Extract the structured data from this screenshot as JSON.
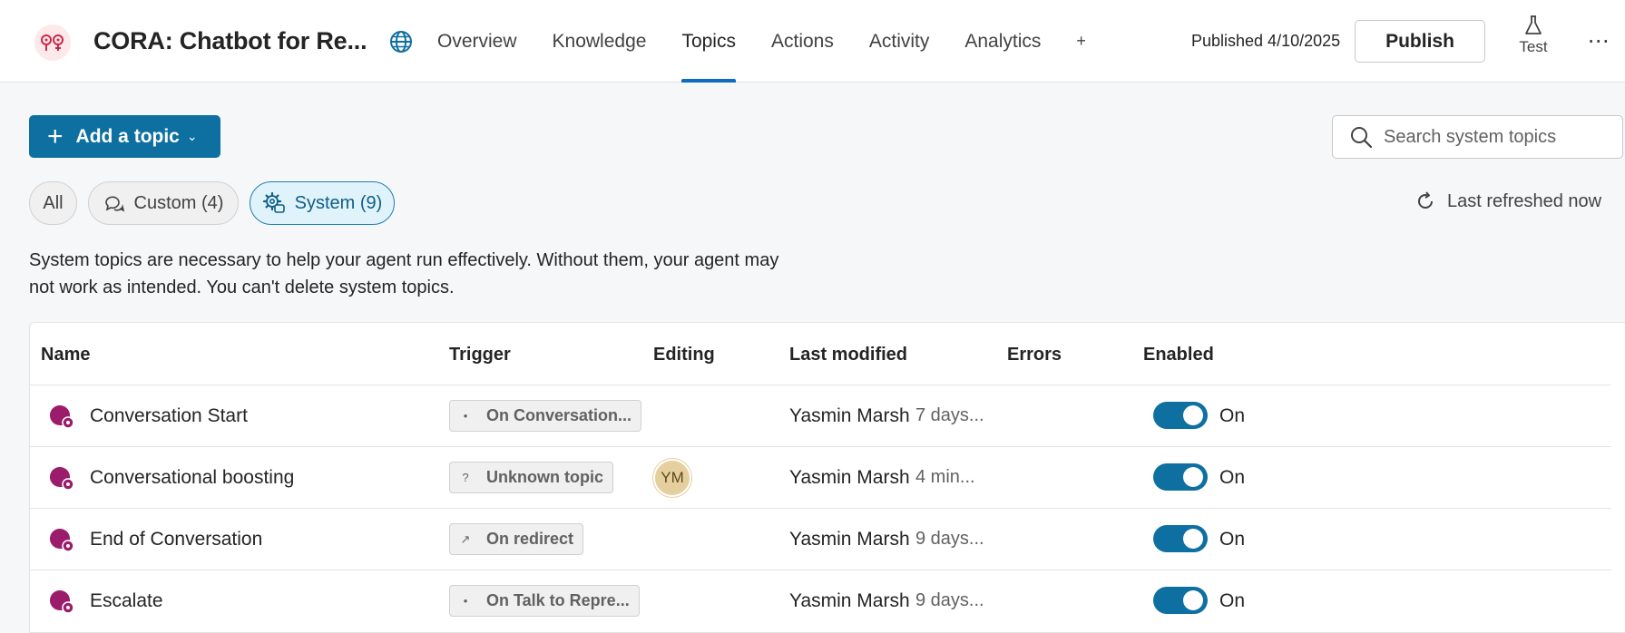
{
  "header": {
    "app_title": "CORA: Chatbot for Re...",
    "nav": [
      {
        "label": "Overview"
      },
      {
        "label": "Knowledge"
      },
      {
        "label": "Topics",
        "active": true
      },
      {
        "label": "Actions"
      },
      {
        "label": "Activity"
      },
      {
        "label": "Analytics"
      },
      {
        "label": "+"
      }
    ],
    "published_text": "Published 4/10/2025",
    "publish_label": "Publish",
    "test_label": "Test",
    "more_label": "⋯"
  },
  "toolbar": {
    "add_topic_label": "Add a topic",
    "search_placeholder": "Search system topics",
    "filters": [
      {
        "label": "All"
      },
      {
        "label": "Custom (4)"
      },
      {
        "label": "System (9)",
        "selected": true
      }
    ],
    "refresh_label": "Last refreshed now"
  },
  "notice": "System topics are necessary to help your agent run effectively. Without them, your agent may not work as intended. You can't delete system topics.",
  "table": {
    "columns": [
      "Name",
      "Trigger",
      "Editing",
      "Last modified",
      "Errors",
      "Enabled"
    ],
    "rows": [
      {
        "name": "Conversation Start",
        "trigger_icon": "lightbulb-icon",
        "trigger_glyph": "•",
        "trigger": "On Conversation...",
        "editing": "",
        "modified_by": "Yasmin Marsh",
        "modified_when": "7 days...",
        "errors": "",
        "enabled": "On"
      },
      {
        "name": "Conversational boosting",
        "trigger_icon": "question-icon",
        "trigger_glyph": "?",
        "trigger": "Unknown topic",
        "editing": "YM",
        "modified_by": "Yasmin Marsh",
        "modified_when": "4 min...",
        "errors": "",
        "enabled": "On"
      },
      {
        "name": "End of Conversation",
        "trigger_icon": "redirect-icon",
        "trigger_glyph": "↗",
        "trigger": "On redirect",
        "editing": "",
        "modified_by": "Yasmin Marsh",
        "modified_when": "9 days...",
        "errors": "",
        "enabled": "On"
      },
      {
        "name": "Escalate",
        "trigger_icon": "lightbulb-icon",
        "trigger_glyph": "•",
        "trigger": "On Talk to Repre...",
        "editing": "",
        "modified_by": "Yasmin Marsh",
        "modified_when": "9 days...",
        "errors": "",
        "enabled": "On"
      }
    ]
  },
  "colors": {
    "accent": "#0e70a0",
    "topic_icon": "#9b1c6b",
    "avatar_bg": "#e6cf9e"
  }
}
